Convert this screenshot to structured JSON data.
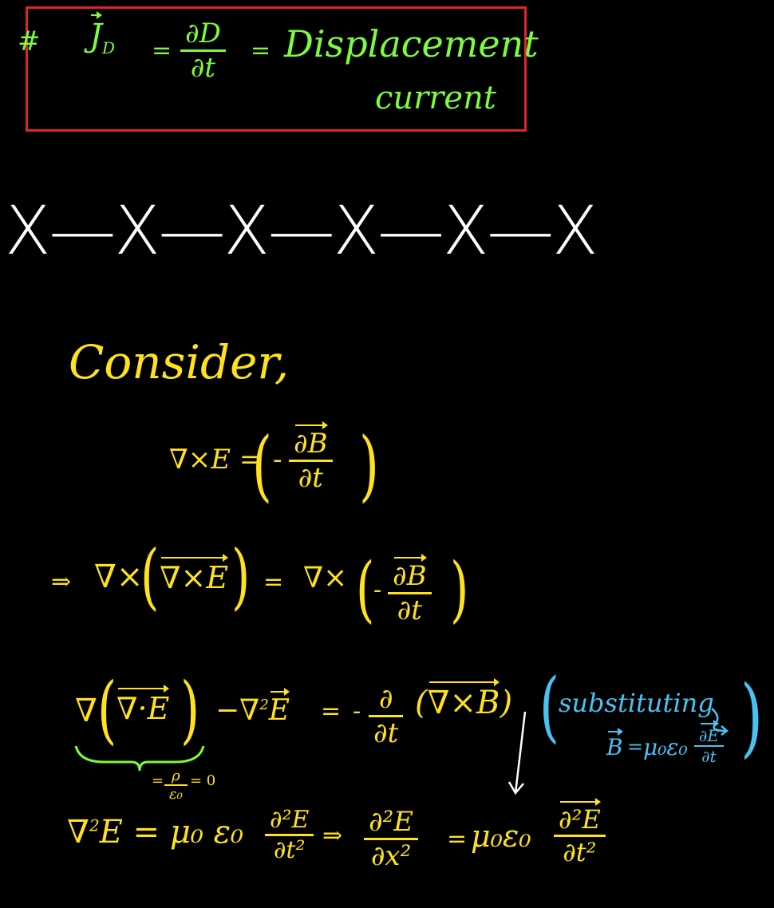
{
  "boxed_equation": {
    "hash": "#",
    "lhs": "J",
    "lhs_sub": "D",
    "eq1": "=",
    "num": "∂D",
    "den": "∂t",
    "eq2": "=",
    "label_line1": "Displacement",
    "label_line2": "current"
  },
  "divider": {
    "mark": "X",
    "dash": "—"
  },
  "heading": "Consider,",
  "eq1": {
    "lhs": "∇×E =",
    "minus": "-",
    "num": "∂B",
    "den": "∂t"
  },
  "eq2": {
    "implies": "⇒",
    "lhs_a": "∇×",
    "lhs_b": "∇×E",
    "eq": "=",
    "rhs_a": "∇×",
    "minus": "-",
    "num": "∂B",
    "den": "∂t"
  },
  "eq3": {
    "grad": "∇",
    "div": "∇·E",
    "minus_lap": "−∇",
    "sq": "2",
    "E": "E",
    "eq": "=",
    "minus": "-",
    "num": "∂",
    "den": "∂t",
    "curlB": "∇×B",
    "under_eq": "=",
    "rho": "ρ",
    "eps0": "ε₀",
    "zero": "= 0"
  },
  "note": {
    "line1": "substituting",
    "B": "B",
    "eq": "=",
    "mu_eps": "μ₀ε₀",
    "num": "∂E",
    "den": "∂t"
  },
  "eq4": {
    "lap": "∇",
    "sq": "2",
    "lhs_tail": "E = μ₀ ε₀",
    "num_a": "∂²E",
    "den_a": "∂t²",
    "implies": "⇒",
    "num_b": "∂²E",
    "den_b": "∂x²",
    "eq": "=",
    "mu_eps": "μ₀ε₀",
    "num_c": "∂²E",
    "den_c": "∂t²"
  },
  "colors": {
    "box": "#E0242C",
    "green": "#7CFC3A",
    "yellow": "#FFE21A",
    "blue": "#49C2F2",
    "white": "#FFFFFF"
  }
}
